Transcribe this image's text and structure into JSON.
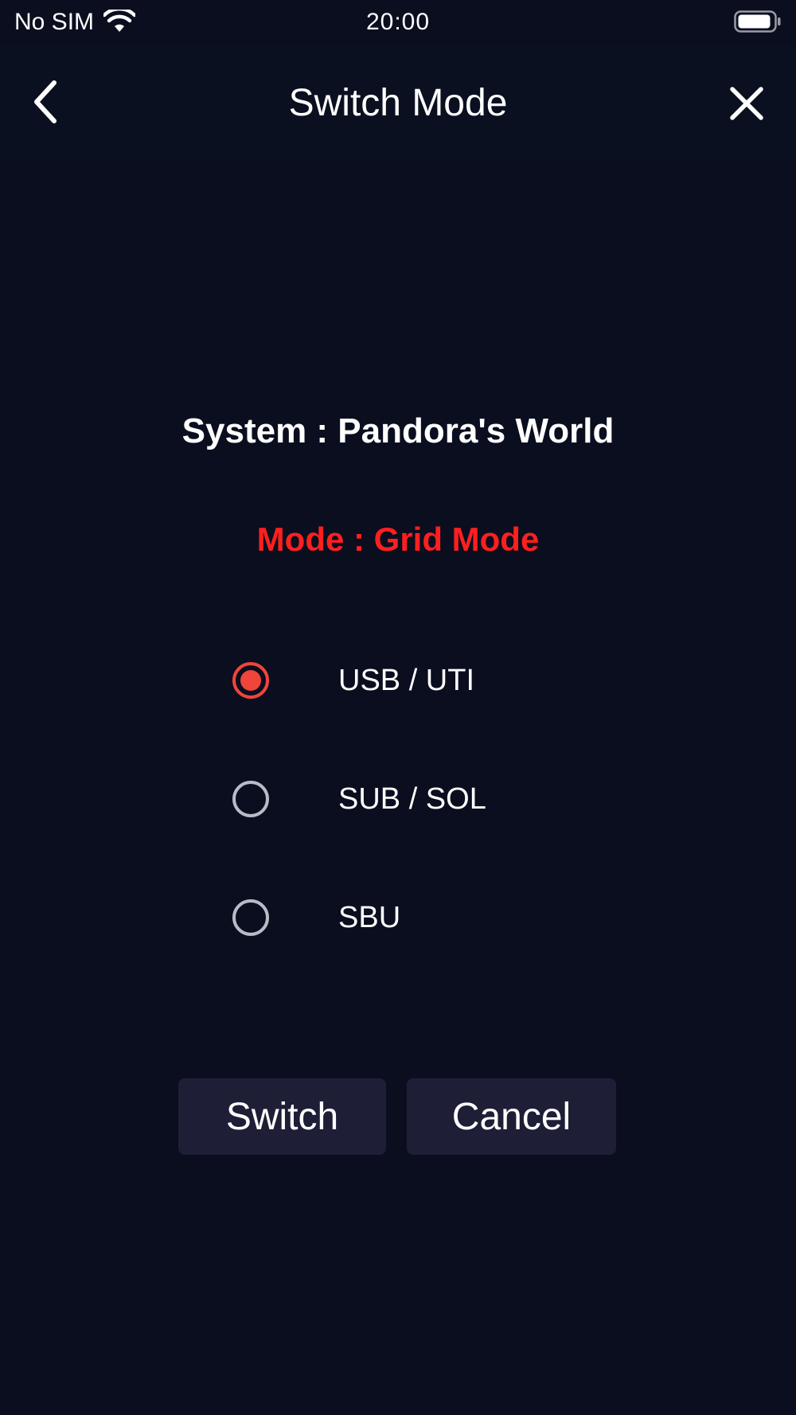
{
  "status_bar": {
    "carrier": "No SIM",
    "time": "20:00",
    "icons": [
      "wifi-icon",
      "battery-icon"
    ]
  },
  "nav": {
    "title": "Switch Mode",
    "back_icon": "chevron-left-icon",
    "close_icon": "close-icon"
  },
  "system": {
    "text": "System : Pandora's World"
  },
  "mode": {
    "text": "Mode : Grid Mode",
    "color": "#ff1f1f"
  },
  "options": [
    {
      "label": "USB / UTI",
      "selected": true
    },
    {
      "label": "SUB / SOL",
      "selected": false
    },
    {
      "label": "SBU",
      "selected": false
    }
  ],
  "buttons": {
    "switch_label": "Switch",
    "cancel_label": "Cancel"
  },
  "colors": {
    "background": "#0a0e1f",
    "radio_selected": "#f0453a",
    "radio_unselected": "#b8bcc6",
    "button_bg": "#1e1f36"
  }
}
